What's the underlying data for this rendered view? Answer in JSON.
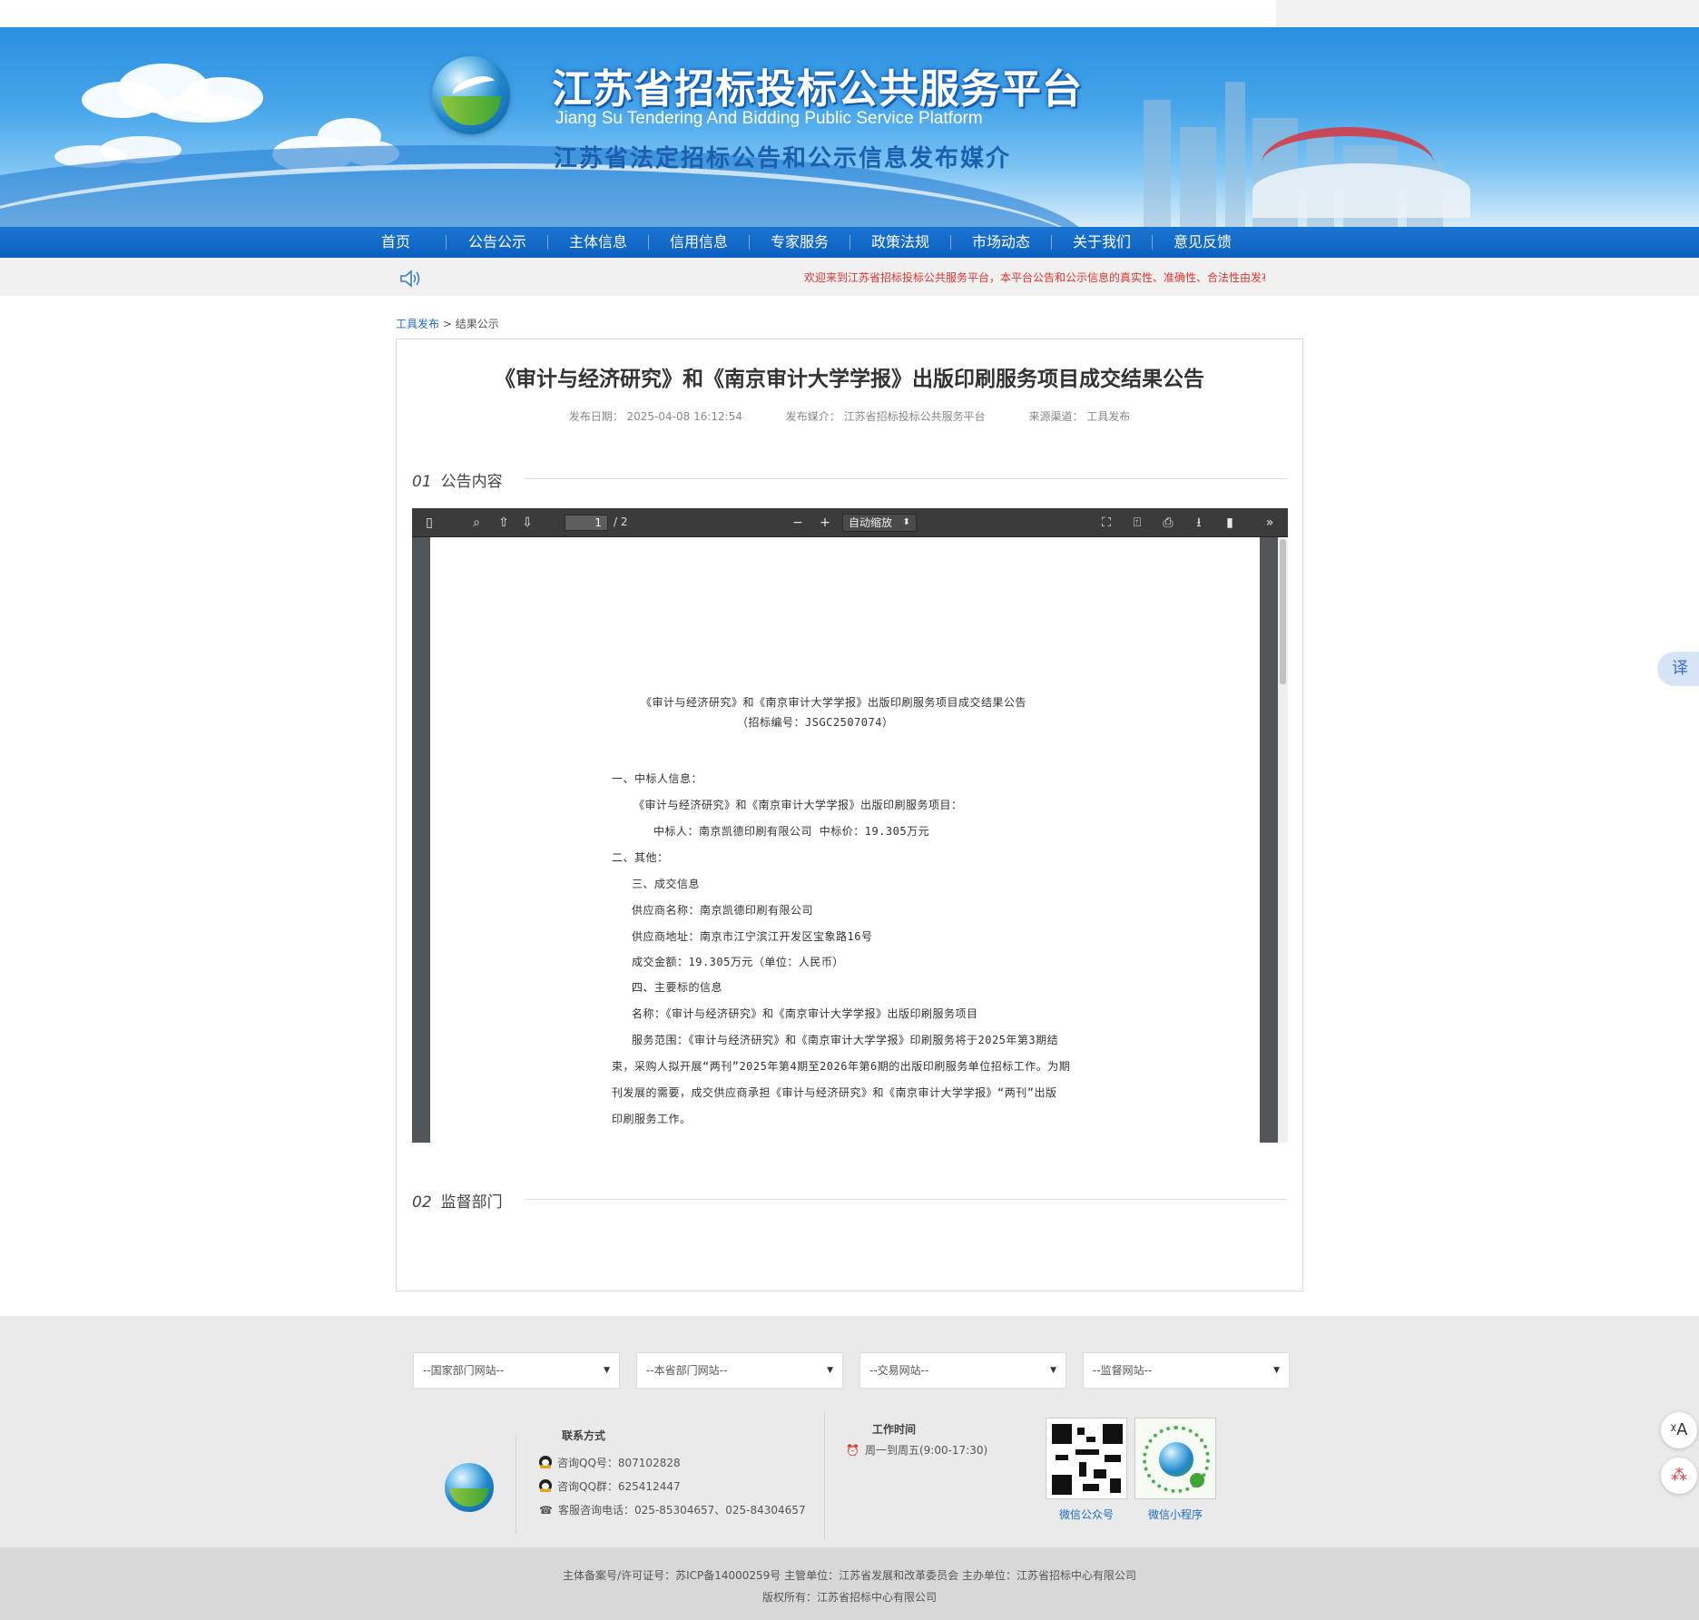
{
  "site": {
    "title": "江苏省招标投标公共服务平台",
    "title_en": "Jiang Su Tendering And Bidding Public Service Platform",
    "subtitle": "江苏省法定招标公告和公示信息发布媒介"
  },
  "nav": {
    "items": [
      "首页",
      "公告公示",
      "主体信息",
      "信用信息",
      "专家服务",
      "政策法规",
      "市场动态",
      "关于我们",
      "意见反馈"
    ]
  },
  "notice": {
    "text": "欢迎来到江苏省招标投标公共服务平台，本平台公告和公示信息的真实性、准确性、合法性由发布"
  },
  "breadcrumb": {
    "link": "工具发布",
    "separator": ">",
    "current": "结果公示"
  },
  "article": {
    "title": "《审计与经济研究》和《南京审计大学学报》出版印刷服务项目成交结果公告",
    "publish_date": "发布日期：  2025-04-08 16:12:54",
    "publish_media": "发布媒介：  江苏省招标投标公共服务平台",
    "source_channel": "来源渠道：  工具发布"
  },
  "sections": [
    {
      "num": "01",
      "label": "公告内容"
    },
    {
      "num": "02",
      "label": "监督部门"
    }
  ],
  "pdf_viewer": {
    "page_current": "1",
    "page_total": "/ 2",
    "zoom_label": "自动缩放",
    "zoom_caret": "⬍",
    "icons": {
      "sidebar": "▯",
      "search": "⌕",
      "prev": "⇧",
      "next": "⇩",
      "zoom_out": "−",
      "zoom_in": "+",
      "fullscreen": "⛶",
      "open": "⍐",
      "print": "⎙",
      "download": "⭳",
      "bookmark": "▮",
      "tools": "»"
    },
    "document_lines": [
      "《审计与经济研究》和《南京审计大学学报》出版印刷服务项目成交结果公告",
      "（招标编号：JSGC2507074）",
      "一、中标人信息：",
      "《审计与经济研究》和《南京审计大学学报》出版印刷服务项目：",
      "中标人：南京凯德印刷有限公司  中标价：19.305万元",
      "二、其他：",
      "三、成交信息",
      "供应商名称：南京凯德印刷有限公司",
      "供应商地址：南京市江宁滨江开发区宝象路16号",
      "成交金额：19.305万元（单位：人民币）",
      "四、主要标的信息",
      "名称：《审计与经济研究》和《南京审计大学学报》出版印刷服务项目",
      "服务范围：《审计与经济研究》和《南京审计大学学报》印刷服务将于2025年第3期结",
      "束，采购人拟开展“两刊”2025年第4期至2026年第6期的出版印刷服务单位招标工作。为期",
      "刊发展的需要，成交供应商承担《审计与经济研究》和《南京审计大学学报》“两刊”出版",
      "印刷服务工作。"
    ]
  },
  "footer": {
    "selects": [
      "--国家部门网站--",
      "--本省部门网站--",
      "--交易网站--",
      "--监督网站--"
    ],
    "select_caret": "▼",
    "contact_heading": "联系方式",
    "contact_qq": "咨询QQ号：807102828",
    "contact_qq_group": "咨询QQ群：625412447",
    "contact_phone": "客服咨询电话：025-85304657、025-84304657",
    "phone_icon": "☎",
    "hours_heading": "工作时间",
    "hours": "周一到周五(9:00-17:30)",
    "clock_icon": "⏰",
    "qr_wechat": "微信公众号",
    "qr_miniprogram": "微信小程序",
    "copyright_line1": "主体备案号/许可证号：苏ICP备14000259号 主管单位：江苏省发展和改革委员会 主办单位：江苏省招标中心有限公司",
    "copyright_line2": "版权所有：江苏省招标中心有限公司"
  },
  "floating": {
    "translate_tab": "译",
    "fab1": "ᵡA",
    "fab2": "⁂"
  },
  "colors": {
    "nav_blue": "#0c5fc0",
    "notice_red": "#e4312b",
    "link_blue": "#1a6bc4",
    "pdf_dark": "#525659"
  }
}
